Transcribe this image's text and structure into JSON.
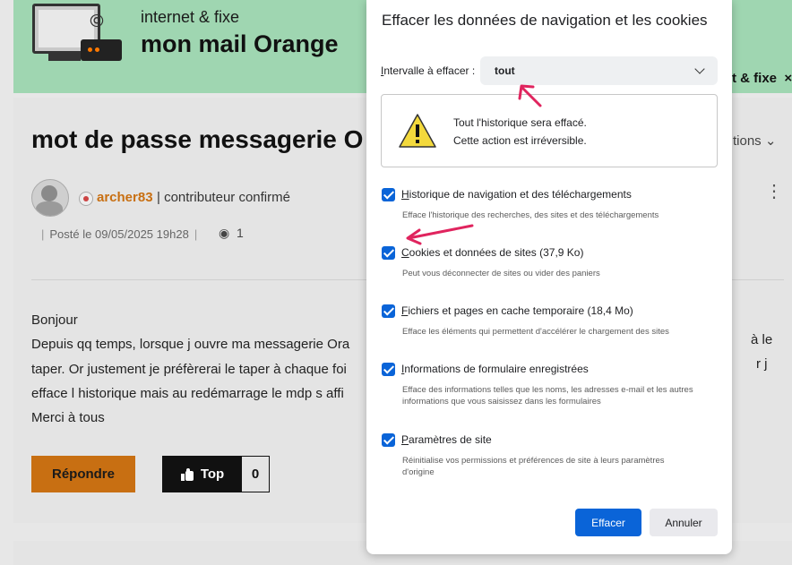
{
  "banner": {
    "subtitle": "internet & fixe",
    "title": "mon mail Orange",
    "right_link": "t & fixe",
    "right_close": "×"
  },
  "post": {
    "title": "mot de passe messagerie O",
    "options_label": "tions",
    "author": "archer83",
    "role": "| contributeur confirmé",
    "date": "Posté le 09/05/2025 19h28",
    "views": "1",
    "body": [
      "Bonjour",
      "Depuis qq temps, lorsque j ouvre ma messagerie Ora",
      "taper. Or justement je préfèrerai le taper à chaque foi",
      "efface l historique mais au redémarrage le mdp s affi",
      "Merci à tous"
    ],
    "body_right": [
      "à le",
      "r j"
    ],
    "reply_button": "Répondre",
    "top_button": "Top",
    "top_count": "0"
  },
  "dialog": {
    "title": "Effacer les données de navigation et les cookies",
    "interval_label_u": "I",
    "interval_label_rest": "ntervalle à effacer :",
    "interval_value": "tout",
    "warning_line1": "Tout l'historique sera effacé.",
    "warning_line2": "Cette action est irréversible.",
    "options": [
      {
        "u": "H",
        "rest": "istorique de navigation et des téléchargements",
        "desc": "Efface l'historique des recherches, des sites et des téléchargements",
        "checked": true
      },
      {
        "u": "C",
        "rest": "ookies et données de sites (37,9 Ko)",
        "desc": "Peut vous déconnecter de sites ou vider des paniers",
        "checked": true
      },
      {
        "u": "F",
        "rest": "ichiers et pages en cache temporaire (18,4 Mo)",
        "desc": "Efface les éléments qui permettent d'accélérer le chargement des sites",
        "checked": true
      },
      {
        "u": "I",
        "rest": "nformations de formulaire enregistrées",
        "desc": "Efface des informations telles que les noms, les adresses e-mail et les autres informations que vous saisissez dans les formulaires",
        "checked": true
      },
      {
        "u": "P",
        "rest": "aramètres de site",
        "desc": "Réinitialise vos permissions et préférences de site à leurs paramètres d'origine",
        "checked": true
      }
    ],
    "confirm_button": "Effacer",
    "cancel_button": "Annuler"
  },
  "colors": {
    "banner": "#9fd6b1",
    "accent_orange": "#c86f12",
    "checkbox_blue": "#0a64d8",
    "annotation_arrow": "#e0245e"
  }
}
